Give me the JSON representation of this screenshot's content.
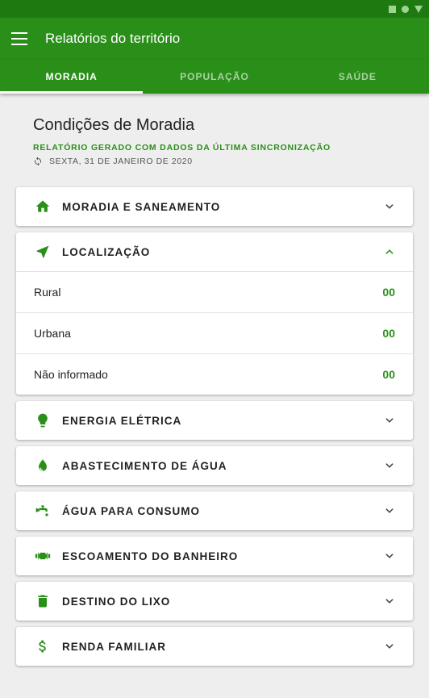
{
  "app": {
    "title": "Relatórios do território"
  },
  "tabs": [
    {
      "label": "MORADIA",
      "active": true
    },
    {
      "label": "POPULAÇÃO",
      "active": false
    },
    {
      "label": "SAÚDE",
      "active": false
    }
  ],
  "header": {
    "title": "Condições de Moradia",
    "subtitle": "RELATÓRIO GERADO COM DADOS DA ÚLTIMA SINCRONIZAÇÃO",
    "date": "SEXTA, 31 DE JANEIRO DE 2020",
    "date_icon": "sync-icon"
  },
  "colors": {
    "primary": "#2a8f19",
    "primary_dark": "#1e7a10",
    "background": "#eeeeee"
  },
  "sections": [
    {
      "title": "MORADIA E SANEAMENTO",
      "icon": "home-icon",
      "expanded": false
    },
    {
      "title": "LOCALIZAÇÃO",
      "icon": "navigation-icon",
      "expanded": true,
      "rows": [
        {
          "label": "Rural",
          "value": "00"
        },
        {
          "label": "Urbana",
          "value": "00"
        },
        {
          "label": "Não informado",
          "value": "00"
        }
      ]
    },
    {
      "title": "ENERGIA ELÉTRICA",
      "icon": "lightbulb-icon",
      "expanded": false
    },
    {
      "title": "ABASTECIMENTO DE ÁGUA",
      "icon": "water-drop-icon",
      "expanded": false
    },
    {
      "title": "ÁGUA PARA CONSUMO",
      "icon": "faucet-icon",
      "expanded": false
    },
    {
      "title": "ESCOAMENTO DO BANHEIRO",
      "icon": "plumbing-icon",
      "expanded": false
    },
    {
      "title": "DESTINO DO LIXO",
      "icon": "trash-icon",
      "expanded": false
    },
    {
      "title": "RENDA FAMILIAR",
      "icon": "dollar-icon",
      "expanded": false
    }
  ]
}
